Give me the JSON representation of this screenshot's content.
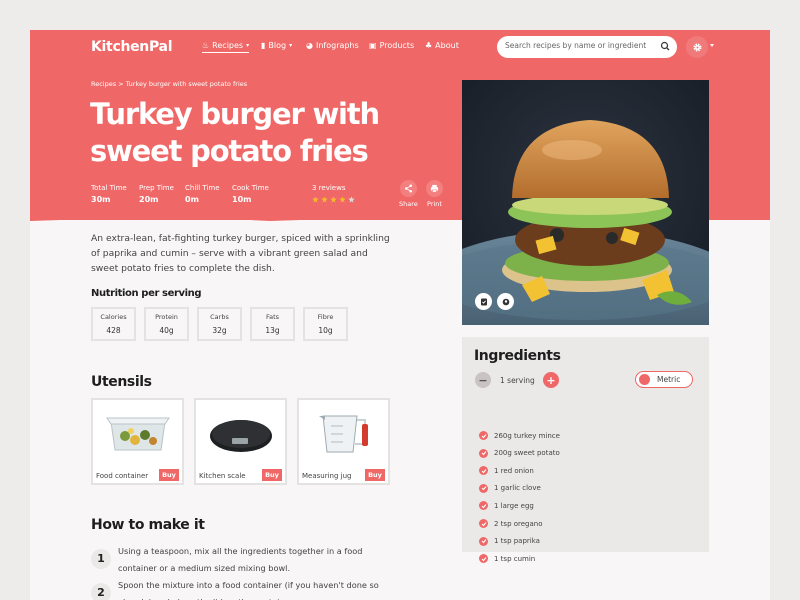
{
  "app": {
    "logo": "KitchenPal"
  },
  "nav": {
    "items": [
      {
        "label": "Recipes",
        "icon": "chef-hat-icon",
        "caret": "▾"
      },
      {
        "label": "Blog",
        "icon": "book-icon",
        "caret": "▾"
      },
      {
        "label": "Infographs",
        "icon": "chart-icon"
      },
      {
        "label": "Products",
        "icon": "bag-icon"
      },
      {
        "label": "About",
        "icon": "people-icon"
      }
    ],
    "search_placeholder": "Search recipes by name or ingredient"
  },
  "breadcrumb": "Recipes > Turkey burger with sweet potato fries",
  "recipe": {
    "title": "Turkey burger with sweet potato fries",
    "times": [
      {
        "label": "Total Time",
        "value": "30m"
      },
      {
        "label": "Prep Time",
        "value": "20m"
      },
      {
        "label": "Chill Time",
        "value": "0m"
      },
      {
        "label": "Cook Time",
        "value": "10m"
      }
    ],
    "reviews": "3 reviews",
    "rating": 4,
    "rating_max": 5,
    "actions": [
      {
        "label": "Share",
        "icon": "share-icon"
      },
      {
        "label": "Print",
        "icon": "print-icon"
      }
    ],
    "intro": "An extra-lean, fat-fighting turkey burger, spiced with a sprinkling of paprika and cumin – serve with a vibrant green salad and sweet potato fries to complete the dish."
  },
  "nutrition": {
    "heading": "Nutrition per serving",
    "items": [
      {
        "label": "Calories",
        "value": "428"
      },
      {
        "label": "Protein",
        "value": "40g"
      },
      {
        "label": "Carbs",
        "value": "32g"
      },
      {
        "label": "Fats",
        "value": "13g"
      },
      {
        "label": "Fibre",
        "value": "10g"
      }
    ]
  },
  "utensils": {
    "heading": "Utensils",
    "buy_label": "Buy",
    "items": [
      {
        "label": "Food container"
      },
      {
        "label": "Kitchen scale"
      },
      {
        "label": "Measuring jug"
      }
    ]
  },
  "method": {
    "heading": "How to make it",
    "steps": [
      {
        "num": "1",
        "text": "Using a teaspoon, mix all the ingredients together in a food container or a medium sized mixing bowl."
      },
      {
        "num": "2",
        "text": "Spoon the mixture into a food container (if you haven't done so already) and place the lid on the container."
      }
    ]
  },
  "ingredients": {
    "heading": "Ingredients",
    "servings": "1 serving",
    "unit_toggle": "Metric",
    "items": [
      "260g turkey mince",
      "200g sweet potato",
      "1 red onion",
      "1 garlic clove",
      "1 large egg",
      "2 tsp oregano",
      "1 tsp paprika",
      "1 tsp cumin"
    ]
  },
  "colors": {
    "accent": "#ef6867",
    "background": "#f8f6f6",
    "panel": "#ebe8e8",
    "star_filled": "#f5b82e",
    "star_empty": "#d9d9d9"
  }
}
